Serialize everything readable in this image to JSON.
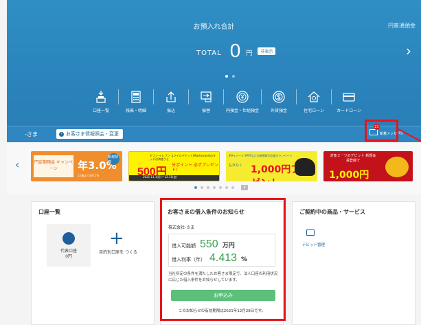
{
  "hero": {
    "title": "お預入れ合計",
    "top_right": "円普通預金",
    "total_label": "TOTAL",
    "total_value": "0",
    "total_unit": "円",
    "display_button": "非表示",
    "next_arrow": "›"
  },
  "menu": [
    {
      "label": "口座一覧",
      "icon": "account-list-icon"
    },
    {
      "label": "残高・明細",
      "icon": "calculator-icon"
    },
    {
      "label": "振込",
      "icon": "upload-transfer-icon"
    },
    {
      "label": "振替",
      "icon": "transfer-icon"
    },
    {
      "label": "円預金・仕組預金",
      "icon": "yen-deposit-icon"
    },
    {
      "label": "外貨預金",
      "icon": "foreign-deposit-icon"
    },
    {
      "label": "住宅ローン",
      "icon": "home-loan-icon"
    },
    {
      "label": "カードローン",
      "icon": "card-loan-icon"
    }
  ],
  "strip": {
    "user": "-さま",
    "info_button": "お客さま情報照会・変更",
    "mail_badge": "21",
    "mail_label": "新着メッセージ",
    "mail_cont": "ジ"
  },
  "banners": [
    {
      "left_text": "円定期預金 キャンペーン",
      "big": "年3.0%",
      "badge": "新規特典",
      "note": "12週まで年0.1%"
    },
    {
      "top": "セブン-イレブン スマイルデビット(Mastercard)のタッチ決済使うと",
      "big": "500円",
      "sub": "分ポイント 必ずプレゼント!",
      "date": "2021.11.1(月)〜12.31(金)"
    },
    {
      "top": "JRA×ミーツ SPATなどの新規取引応援キャンペーン",
      "pre": "もれなく",
      "big": "1,000円プレゼント"
    },
    {
      "top": "対象ミーツのデビット 新規会員登録で",
      "big": "1,000円"
    }
  ],
  "banner_left_arrow": "‹",
  "banner_pause": "II",
  "cards": {
    "accounts": {
      "title": "口座一覧",
      "rep_label": "代表口座",
      "rep_value": "0円",
      "add_label": "目的別口座を つくる",
      "plus": "+"
    },
    "loan": {
      "title": "お客さまの借入条件のお知らせ",
      "company": "株式会社-さま",
      "limit_label": "借入可能額",
      "limit_value": "550",
      "limit_unit": "万円",
      "rate_label": "借入利率（年）",
      "rate_value": "4.413",
      "rate_unit": "%",
      "desc": "当社所定の条件を満たしたお客さま限定で、法人口座の利用状況に応じた借入条件をお知らせしています。",
      "apply": "お申込み",
      "valid": "このお知らせの有効期限は2021年12月28日です。"
    },
    "services": {
      "title": "ご契約中の商品・サービス",
      "item": "デビット管理"
    }
  },
  "colors": {
    "hero_blue": "#2b84bd",
    "highlight_red": "#e8131b",
    "loan_green": "#3aa04f",
    "apply_green": "#5cc07a"
  }
}
